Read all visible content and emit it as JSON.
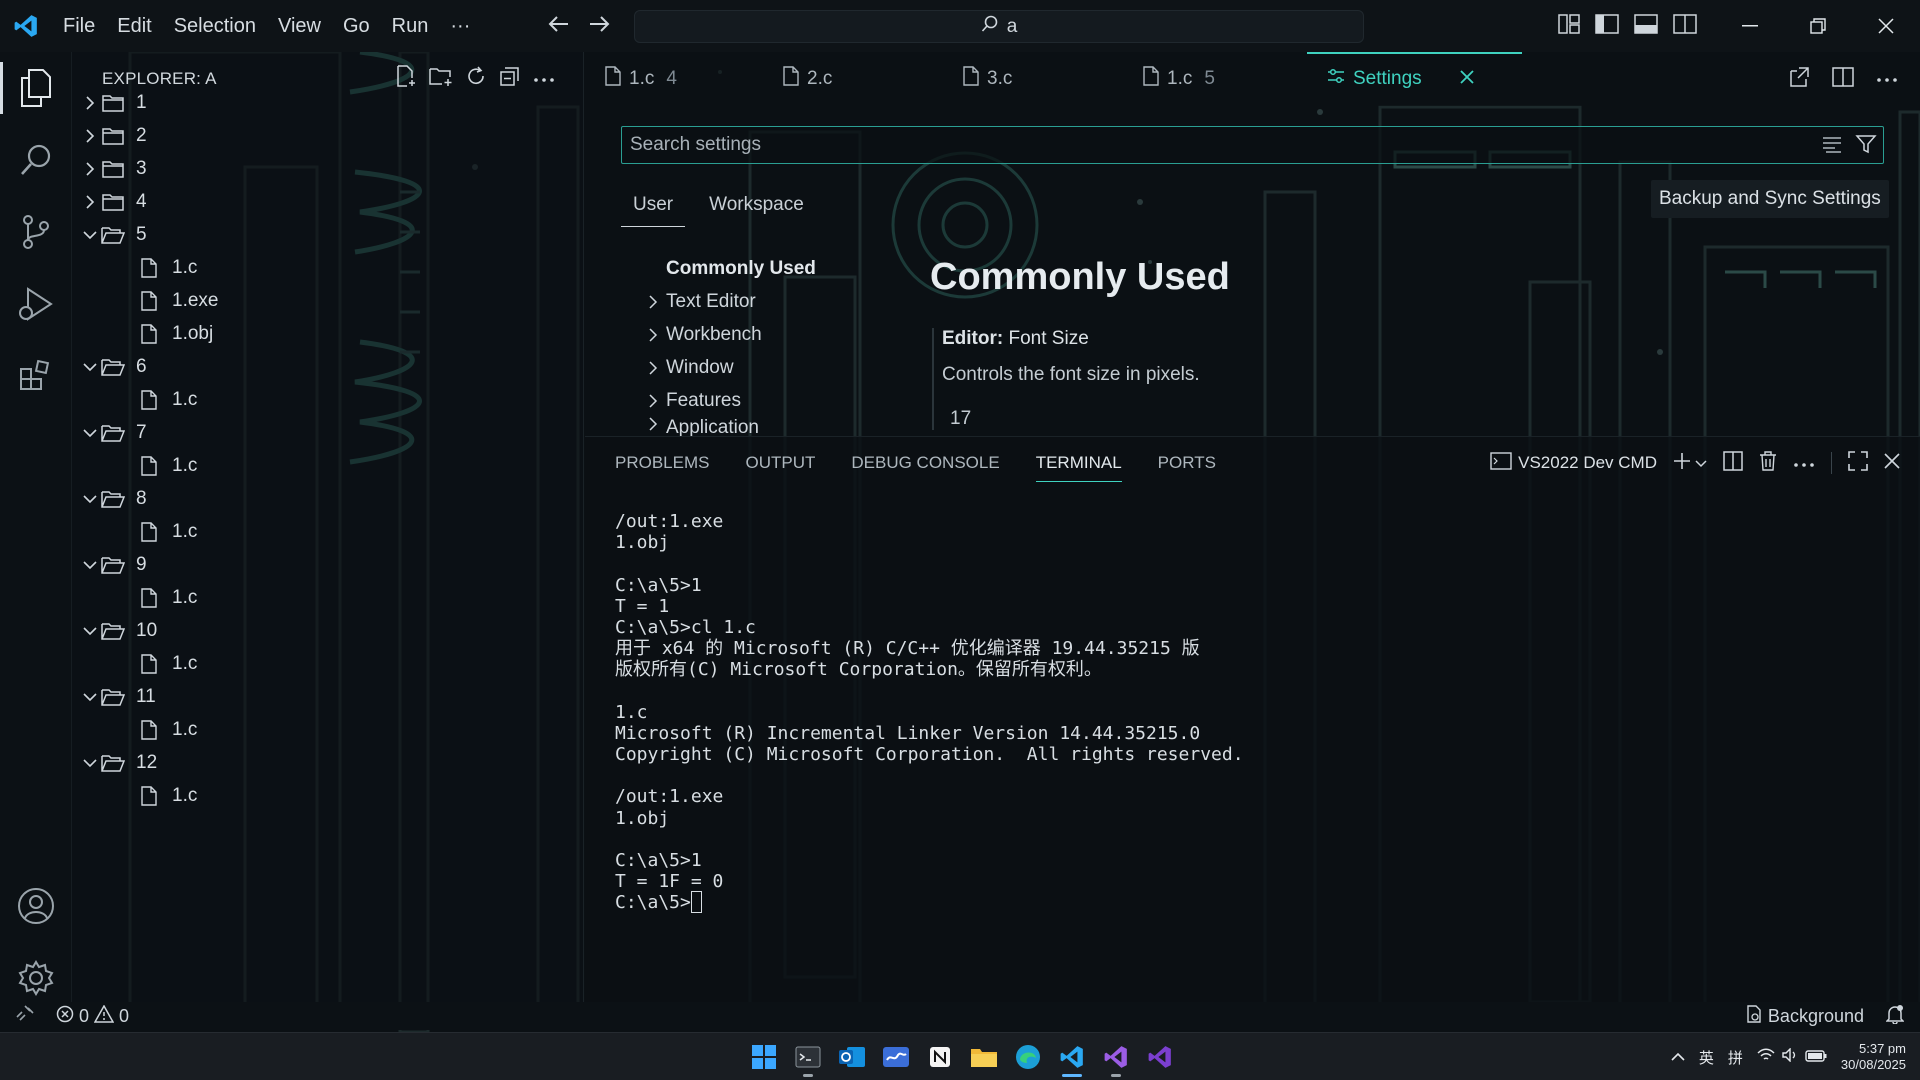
{
  "titlebar": {
    "menu": [
      "File",
      "Edit",
      "Selection",
      "View",
      "Go",
      "Run",
      "···"
    ],
    "command_center": "a"
  },
  "sidebar": {
    "title": "EXPLORER: A",
    "tree": [
      {
        "label": "1",
        "type": "folder",
        "open": false,
        "depth": 0
      },
      {
        "label": "2",
        "type": "folder",
        "open": false,
        "depth": 0
      },
      {
        "label": "3",
        "type": "folder",
        "open": false,
        "depth": 0
      },
      {
        "label": "4",
        "type": "folder",
        "open": false,
        "depth": 0
      },
      {
        "label": "5",
        "type": "folder",
        "open": true,
        "depth": 0
      },
      {
        "label": "1.c",
        "type": "file",
        "depth": 1
      },
      {
        "label": "1.exe",
        "type": "file",
        "depth": 1
      },
      {
        "label": "1.obj",
        "type": "file",
        "depth": 1
      },
      {
        "label": "6",
        "type": "folder",
        "open": true,
        "depth": 0
      },
      {
        "label": "1.c",
        "type": "file",
        "depth": 1
      },
      {
        "label": "7",
        "type": "folder",
        "open": true,
        "depth": 0
      },
      {
        "label": "1.c",
        "type": "file",
        "depth": 1
      },
      {
        "label": "8",
        "type": "folder",
        "open": true,
        "depth": 0
      },
      {
        "label": "1.c",
        "type": "file",
        "depth": 1
      },
      {
        "label": "9",
        "type": "folder",
        "open": true,
        "depth": 0
      },
      {
        "label": "1.c",
        "type": "file",
        "depth": 1
      },
      {
        "label": "10",
        "type": "folder",
        "open": true,
        "depth": 0
      },
      {
        "label": "1.c",
        "type": "file",
        "depth": 1
      },
      {
        "label": "11",
        "type": "folder",
        "open": true,
        "depth": 0
      },
      {
        "label": "1.c",
        "type": "file",
        "depth": 1
      },
      {
        "label": "12",
        "type": "folder",
        "open": true,
        "depth": 0
      },
      {
        "label": "1.c",
        "type": "file",
        "depth": 1
      }
    ]
  },
  "tabs": [
    {
      "label": "1.c",
      "badge": "4"
    },
    {
      "label": "2.c",
      "badge": ""
    },
    {
      "label": "3.c",
      "badge": ""
    },
    {
      "label": "1.c",
      "badge": "5"
    },
    {
      "label": "Settings",
      "badge": "",
      "active": true
    }
  ],
  "settings": {
    "search_placeholder": "Search settings",
    "scopes": [
      "User",
      "Workspace"
    ],
    "sync_button": "Backup and Sync Settings",
    "toc_heading": "Commonly Used",
    "toc": [
      "Text Editor",
      "Workbench",
      "Window",
      "Features",
      "Application"
    ],
    "section_title": "Commonly Used",
    "item": {
      "category": "Editor: ",
      "name": "Font Size",
      "description": "Controls the font size in pixels.",
      "value": "17"
    }
  },
  "panel": {
    "tabs": [
      "PROBLEMS",
      "OUTPUT",
      "DEBUG CONSOLE",
      "TERMINAL",
      "PORTS"
    ],
    "active_tab": "TERMINAL",
    "terminal_profile": "VS2022 Dev CMD",
    "terminal_lines": [
      "/out:1.exe",
      "1.obj",
      "",
      "C:\\a\\5>1",
      "T = 1",
      "C:\\a\\5>cl 1.c",
      "用于 x64 的 Microsoft (R) C/C++ 优化编译器 19.44.35215 版",
      "版权所有(C) Microsoft Corporation。保留所有权利。",
      "",
      "1.c",
      "Microsoft (R) Incremental Linker Version 14.44.35215.0",
      "Copyright (C) Microsoft Corporation.  All rights reserved.",
      "",
      "/out:1.exe",
      "1.obj",
      "",
      "C:\\a\\5>1",
      "T = 1F = 0"
    ],
    "prompt": "C:\\a\\5>"
  },
  "statusbar": {
    "errors": "0",
    "warnings": "0",
    "background": "Background"
  },
  "taskbar": {
    "ime_lang": "英",
    "ime_mode": "拼",
    "time": "5:37 pm",
    "date": "30/08/2025"
  },
  "colors": {
    "accent": "#3fd2c0",
    "background": "#0b1014",
    "vscode_blue": "#2aa8f2"
  }
}
